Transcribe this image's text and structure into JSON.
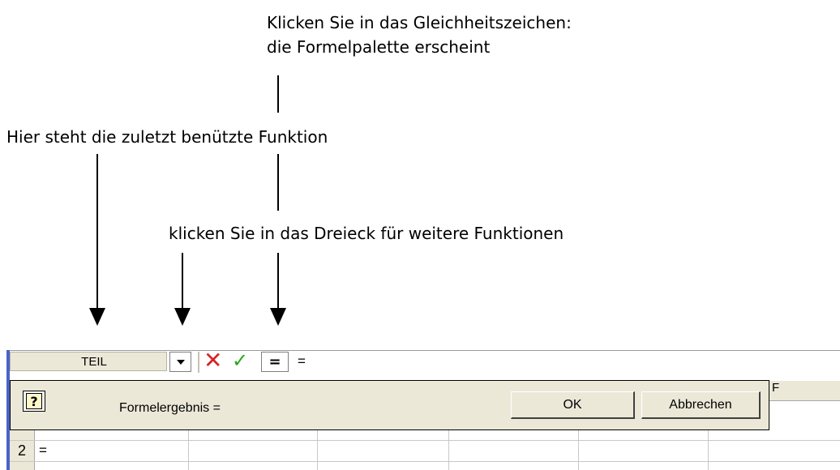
{
  "annotations": {
    "note1_line1": "Klicken Sie in das Gleichheitszeichen:",
    "note1_line2": "die Formelpalette erscheint",
    "note2": "Hier steht die zuletzt benützte Funktion",
    "note3": "klicken Sie in das Dreieck für weitere Funktionen"
  },
  "formula_bar": {
    "name_box": "TEIL",
    "cancel_icon": "x-icon",
    "confirm_icon": "check-icon",
    "equals_button": "=",
    "content": "="
  },
  "grid": {
    "column_letter_visible": "F",
    "row2_label": "2",
    "cell_a2": "="
  },
  "formula_palette": {
    "help_icon": "?",
    "result_label": "Formelergebnis =",
    "ok_label": "OK",
    "cancel_label": "Abbrechen"
  },
  "colors": {
    "cancel_x": "#d42525",
    "confirm_check": "#2aa51d",
    "panel_bg": "#ece8d8"
  }
}
